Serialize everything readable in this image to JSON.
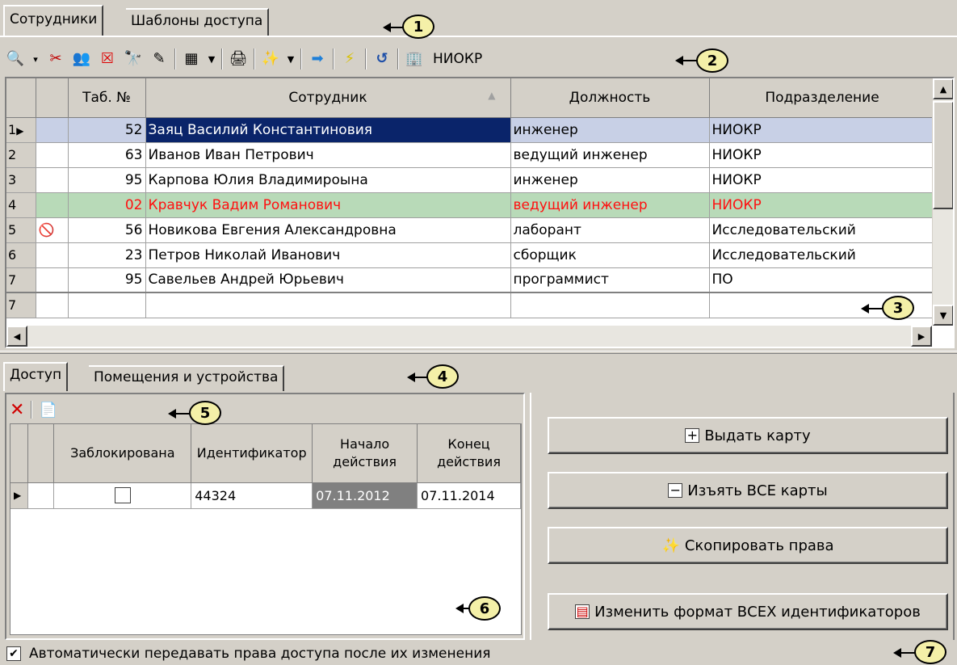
{
  "top_tabs": [
    "Сотрудники",
    "Шаблоны доступа"
  ],
  "toolbar": {
    "department": "НИОКР",
    "icons": [
      "filter-icon",
      "dropdown-arrow-icon",
      "cut-user-icon",
      "users-icon",
      "delete-user-icon",
      "find-icon",
      "edit-icon",
      "view-columns-icon",
      "dropdown-arrow-icon",
      "print-icon",
      "wizard-icon",
      "dropdown-arrow-icon",
      "transfer-arrow-icon",
      "lightning-icon",
      "refresh-icon",
      "department-icon"
    ]
  },
  "grid": {
    "headers": [
      "",
      "",
      "Таб. №",
      "Сотрудник",
      "Должность",
      "Подразделение"
    ],
    "sort_indicator": "▲",
    "rows": [
      {
        "n": "1",
        "marker": "▶",
        "tab": "52",
        "name": "Заяц Василий Константиновия",
        "position": "инженер",
        "dept": "НИОКР",
        "state": "selected"
      },
      {
        "n": "2",
        "marker": "",
        "tab": "63",
        "name": "Иванов Иван Петрович",
        "position": "ведущий инженер",
        "dept": "НИОКР",
        "state": ""
      },
      {
        "n": "3",
        "marker": "",
        "tab": "95",
        "name": "Карпова Юлия Владимироына",
        "position": "инженер",
        "dept": "НИОКР",
        "state": ""
      },
      {
        "n": "4",
        "marker": "",
        "tab": "02",
        "name": "Кравчук Вадим Романович",
        "position": "ведущий инженер",
        "dept": "НИОКР",
        "state": "green"
      },
      {
        "n": "5",
        "marker": "",
        "tab": "56",
        "name": "Новикова Евгения Александровна",
        "position": "лаборант",
        "dept": "Исследовательский",
        "state": "blocked"
      },
      {
        "n": "6",
        "marker": "",
        "tab": "23",
        "name": "Петров Николай Иванович",
        "position": "сборщик",
        "dept": "Исследовательский",
        "state": ""
      },
      {
        "n": "7",
        "marker": "",
        "tab": "95",
        "name": "Савельев Андрей Юрьевич",
        "position": "программист",
        "dept": "ПО",
        "state": ""
      }
    ],
    "new_row_number": "7"
  },
  "lower_tabs": [
    "Доступ",
    "Помещения и устройства"
  ],
  "cards": {
    "headers": {
      "blocked": "Заблокирована",
      "identifier": "Идентификатор",
      "start_1": "Начало",
      "start_2": "действия",
      "end_1": "Конец",
      "end_2": "действия"
    },
    "rows": [
      {
        "marker": "▶",
        "identifier": "44324",
        "start": "07.11.2012",
        "end": "07.11.2014"
      }
    ]
  },
  "buttons": {
    "issue": "Выдать карту",
    "withdraw": "Изъять ВСЕ карты",
    "copy": "Скопировать права",
    "format": "Изменить формат ВСЕХ идентификаторов"
  },
  "auto_transfer": "Автоматически передавать права доступа после их изменения",
  "callouts": [
    "1",
    "2",
    "3",
    "4",
    "5",
    "6",
    "7"
  ]
}
